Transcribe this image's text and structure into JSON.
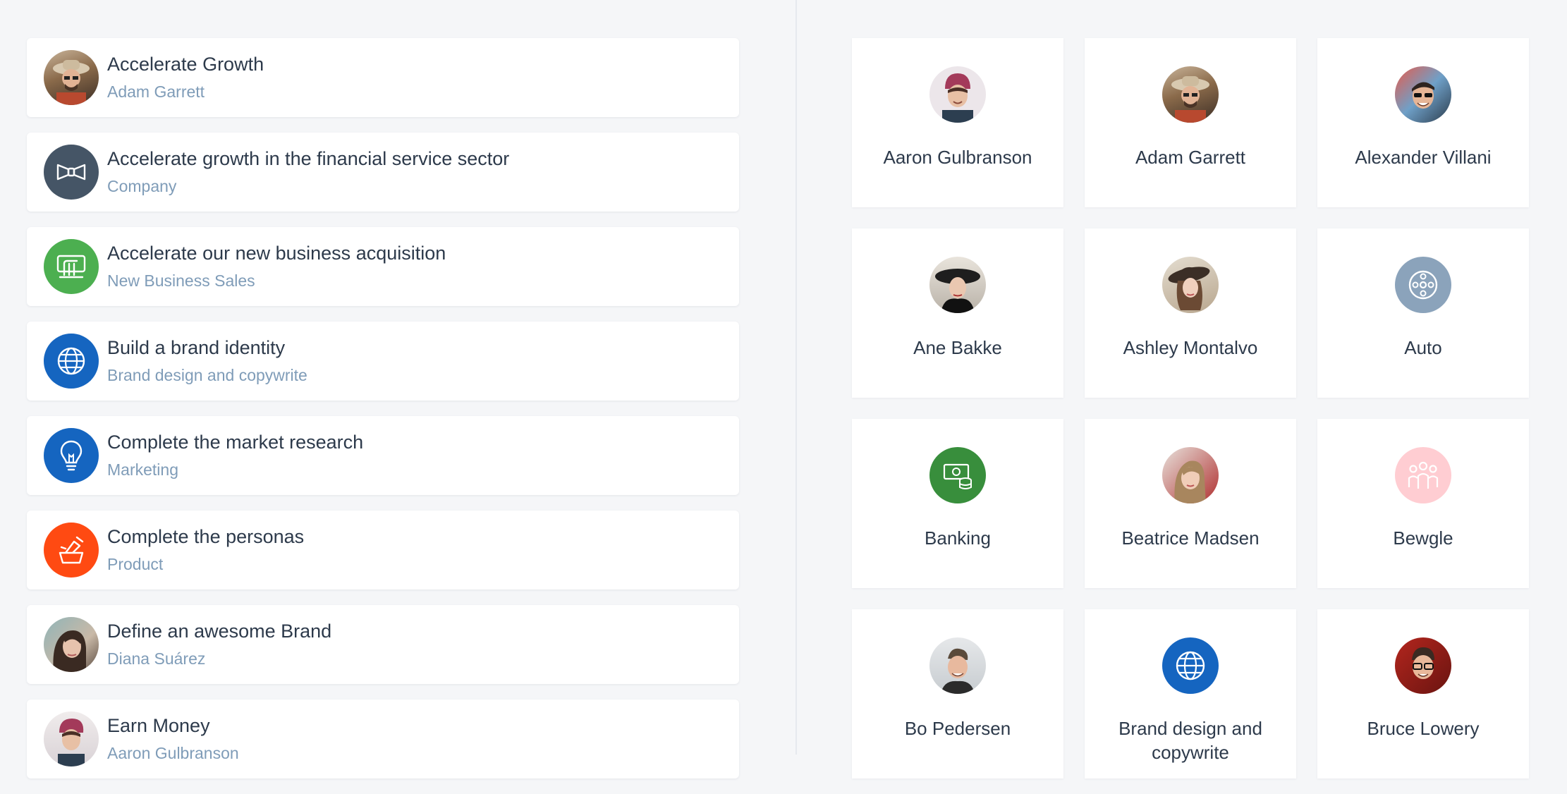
{
  "goals": [
    {
      "title": "Accelerate Growth",
      "subtitle": "Adam Garrett",
      "avatar": "person-photo-adam"
    },
    {
      "title": "Accelerate growth in the financial service sector",
      "subtitle": "Company",
      "avatar": "bowtie-icon",
      "color": "#455566"
    },
    {
      "title": "Accelerate our new business acquisition",
      "subtitle": "New Business Sales",
      "avatar": "sales-icon",
      "color": "#4caf50"
    },
    {
      "title": "Build a brand identity",
      "subtitle": "Brand design and copywrite",
      "avatar": "globe-icon",
      "color": "#1565c0"
    },
    {
      "title": "Complete the market research",
      "subtitle": "Marketing",
      "avatar": "lightbulb-icon",
      "color": "#1565c0"
    },
    {
      "title": "Complete the personas",
      "subtitle": "Product",
      "avatar": "product-icon",
      "color": "#ff4a12"
    },
    {
      "title": "Define an awesome Brand",
      "subtitle": "Diana Suárez",
      "avatar": "person-photo-diana"
    },
    {
      "title": "Earn Money",
      "subtitle": "Aaron Gulbranson",
      "avatar": "person-photo-aaron"
    }
  ],
  "owners": [
    {
      "name": "Aaron Gulbranson",
      "avatar": "person-photo"
    },
    {
      "name": "Adam Garrett",
      "avatar": "person-photo"
    },
    {
      "name": "Alexander Villani",
      "avatar": "person-photo"
    },
    {
      "name": "Ane Bakke",
      "avatar": "person-photo"
    },
    {
      "name": "Ashley Montalvo",
      "avatar": "person-photo"
    },
    {
      "name": "Auto",
      "avatar": "auto-icon",
      "color": "#8ba3bb"
    },
    {
      "name": "Banking",
      "avatar": "banking-icon",
      "color": "#388e3c"
    },
    {
      "name": "Beatrice Madsen",
      "avatar": "person-photo"
    },
    {
      "name": "Bewgle",
      "avatar": "people-icon",
      "color": "#ffcdd2"
    },
    {
      "name": "Bo Pedersen",
      "avatar": "person-photo"
    },
    {
      "name": "Brand design and copywrite",
      "avatar": "globe-icon",
      "color": "#1565c0"
    },
    {
      "name": "Bruce Lowery",
      "avatar": "person-photo"
    }
  ]
}
